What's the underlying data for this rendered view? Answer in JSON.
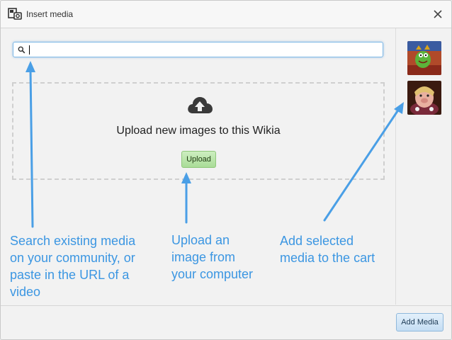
{
  "dialog": {
    "title": "Insert media",
    "close_icon": "close-icon",
    "title_icon": "insert-media-icon"
  },
  "search": {
    "value": "",
    "placeholder": "",
    "icon": "search-icon"
  },
  "upload": {
    "heading": "Upload new images to this Wikia",
    "button_label": "Upload",
    "icon": "cloud-upload-icon"
  },
  "cart": {
    "items": [
      {
        "name": "cart-thumbnail-kermit"
      },
      {
        "name": "cart-thumbnail-miss-piggy"
      }
    ]
  },
  "footer": {
    "add_media_label": "Add Media"
  },
  "annotations": {
    "search": [
      "Search existing media",
      "on your community, or",
      "paste in the URL of a",
      "video"
    ],
    "upload": [
      "Upload an",
      "image from",
      "your computer"
    ],
    "cart": [
      "Add selected",
      "media to the cart"
    ]
  },
  "colors": {
    "annotation": "#3b96e2",
    "upload_button": "#a9dc97",
    "add_media_button": "#c4ddf3"
  }
}
